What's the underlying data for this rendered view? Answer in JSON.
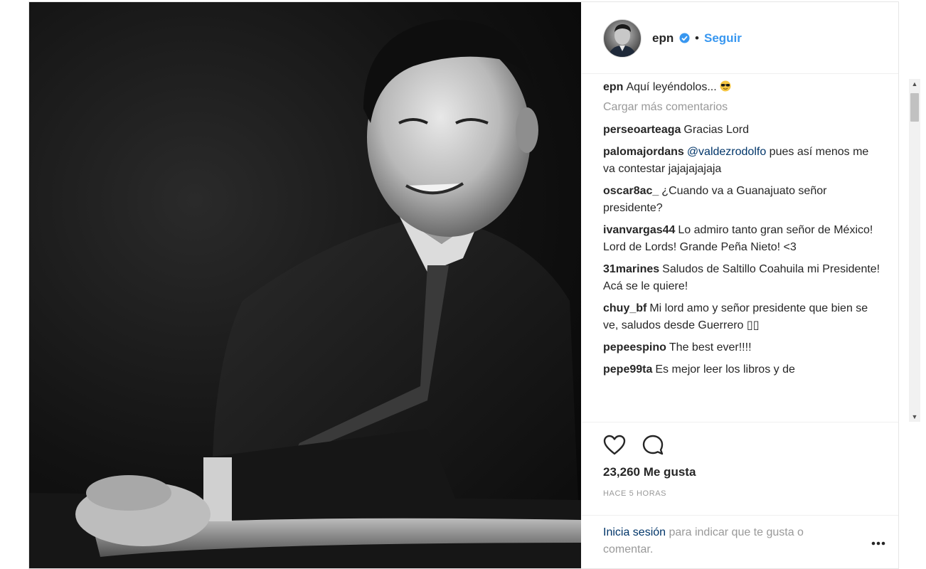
{
  "post": {
    "photo_alt": "photo",
    "colors": {
      "link_blue": "#3897f0",
      "mention_dark_blue": "#003569",
      "text": "#262626",
      "muted": "#999999"
    }
  },
  "header": {
    "username": "epn",
    "verified_icon": "verified-badge-icon",
    "separator": "•",
    "follow_label": "Seguir"
  },
  "caption": {
    "user": "epn",
    "text": "Aquí leyéndolos...",
    "emoji": "sunglasses-emoji"
  },
  "load_more_label": "Cargar más comentarios",
  "comments": [
    {
      "user": "perseoarteaga",
      "text": "Gracias Lord"
    },
    {
      "user": "palomajordans",
      "mention": "@valdezrodolfo",
      "text": " pues así menos me va contestar jajajajajaja"
    },
    {
      "user": "oscar8ac_",
      "text": "¿Cuando va a Guanajuato señor presidente?"
    },
    {
      "user": "ivanvargas44",
      "text": "Lo admiro tanto gran señor de México! Lord de Lords! Grande Peña Nieto! <3"
    },
    {
      "user": "31marines",
      "text": "Saludos de Saltillo Coahuila mi Presidente! Acá se le quiere!"
    },
    {
      "user": "chuy_bf",
      "text": "Mi lord amo y señor presidente que bien se ve, saludos desde Guerrero ▯▯"
    },
    {
      "user": "pepeespino",
      "text": "The best ever!!!!"
    },
    {
      "user": "pepe99ta",
      "text": "Es mejor leer los libros y de"
    }
  ],
  "actions": {
    "like_icon": "heart-outline-icon",
    "comment_icon": "speech-bubble-icon",
    "likes_text": "23,260 Me gusta",
    "time_text": "HACE 5 HORAS"
  },
  "login": {
    "link_label": "Inicia sesión",
    "rest_text": " para indicar que te gusta o comentar.",
    "more_icon": "ellipsis-icon"
  },
  "scrollbar": {
    "up_glyph": "▲",
    "down_glyph": "▼"
  }
}
